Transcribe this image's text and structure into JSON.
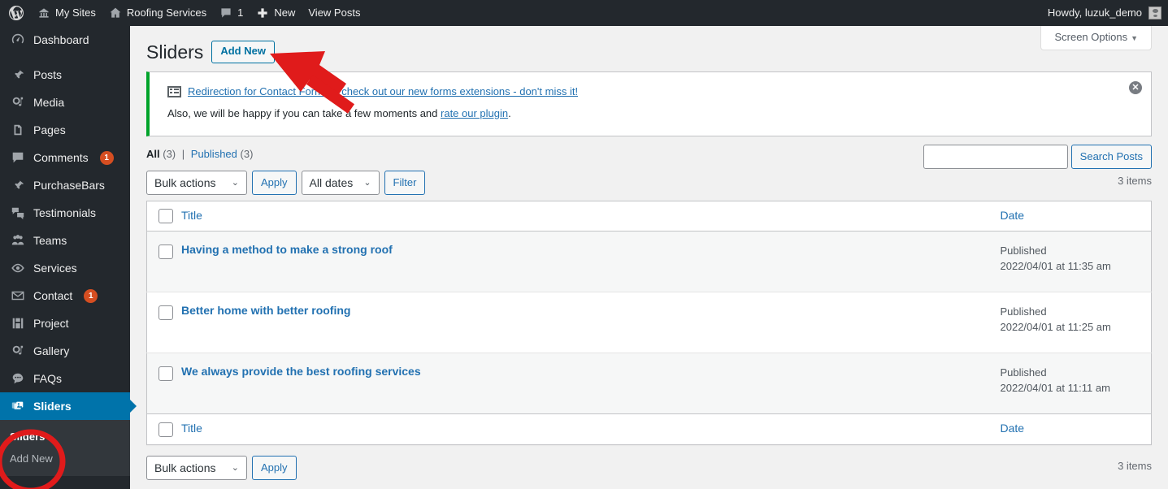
{
  "adminbar": {
    "logo_icon": "wordpress-logo-icon",
    "items": [
      {
        "icon": "sites-icon",
        "label": "My Sites"
      },
      {
        "icon": "home-icon",
        "label": "Roofing Services"
      },
      {
        "icon": "comment-bubble-icon",
        "label": "1"
      },
      {
        "icon": "plus-icon",
        "label": "New"
      },
      {
        "icon": "",
        "label": "View Posts"
      }
    ],
    "howdy": "Howdy, luzuk_demo",
    "avatar_icon": "user-avatar-icon"
  },
  "sidebar": {
    "active_color": "#0073aa",
    "background": "#23282d",
    "items": [
      {
        "icon": "dashboard-icon",
        "label": "Dashboard",
        "badge": "",
        "current": false
      },
      {
        "icon": "pin-icon",
        "label": "Posts",
        "badge": "",
        "current": false
      },
      {
        "icon": "media-icon",
        "label": "Media",
        "badge": "",
        "current": false
      },
      {
        "icon": "pages-icon",
        "label": "Pages",
        "badge": "",
        "current": false
      },
      {
        "icon": "comments-icon",
        "label": "Comments",
        "badge": "1",
        "current": false
      },
      {
        "icon": "pin-icon",
        "label": "PurchaseBars",
        "badge": "",
        "current": false
      },
      {
        "icon": "testimonials-icon",
        "label": "Testimonials",
        "badge": "",
        "current": false
      },
      {
        "icon": "teams-icon",
        "label": "Teams",
        "badge": "",
        "current": false
      },
      {
        "icon": "services-icon",
        "label": "Services",
        "badge": "",
        "current": false
      },
      {
        "icon": "mail-icon",
        "label": "Contact",
        "badge": "1",
        "current": false
      },
      {
        "icon": "project-icon",
        "label": "Project",
        "badge": "",
        "current": false
      },
      {
        "icon": "gallery-icon",
        "label": "Gallery",
        "badge": "",
        "current": false
      },
      {
        "icon": "faqs-icon",
        "label": "FAQs",
        "badge": "",
        "current": false
      },
      {
        "icon": "sliders-icon",
        "label": "Sliders",
        "badge": "",
        "current": true
      }
    ],
    "submenu": [
      {
        "label": "Sliders",
        "current": true
      },
      {
        "label": "Add New",
        "current": false
      }
    ]
  },
  "screen_meta": {
    "screen_options_label": "Screen Options",
    "chevron": "▼"
  },
  "page": {
    "title": "Sliders",
    "add_new_label": "Add New"
  },
  "notice": {
    "accent_color": "#00a32a",
    "icon": "form-list-icon",
    "link_text": "Redirection for Contact Form 7 - check out our new forms extensions - don't miss it!",
    "line2_prefix": "Also, we will be happy if you can take a few moments and ",
    "line2_link": "rate our plugin",
    "line2_suffix": ".",
    "dismiss_icon": "close-icon",
    "dismiss_glyph": "✕"
  },
  "filters": {
    "all_label": "All",
    "all_count": "(3)",
    "separator": "|",
    "published_label": "Published",
    "published_count": "(3)",
    "bulk_actions_value": "Bulk actions",
    "apply_label": "Apply",
    "dates_value": "All dates",
    "filter_label": "Filter",
    "select_arrow": "⌄"
  },
  "search": {
    "value": "",
    "placeholder": "",
    "button_label": "Search Posts"
  },
  "counts": {
    "top_items": "3 items",
    "bottom_items": "3 items"
  },
  "table": {
    "columns": {
      "title": "Title",
      "date": "Date"
    },
    "rows": [
      {
        "title": "Having a method to make a strong roof",
        "status": "Published",
        "date": "2022/04/01 at 11:35 am",
        "alt": true
      },
      {
        "title": "Better home with better roofing",
        "status": "Published",
        "date": "2022/04/01 at 11:25 am",
        "alt": false
      },
      {
        "title": "We always provide the best roofing services",
        "status": "Published",
        "date": "2022/04/01 at 11:11 am",
        "alt": true
      }
    ]
  },
  "bottom_nav": {
    "bulk_actions_value": "Bulk actions",
    "apply_label": "Apply"
  },
  "annotations": {
    "color": "#e01b1b",
    "arrow_name": "red-arrow-pointing-to-add-new",
    "ellipse_name": "red-ellipse-around-sliders-submenu"
  }
}
